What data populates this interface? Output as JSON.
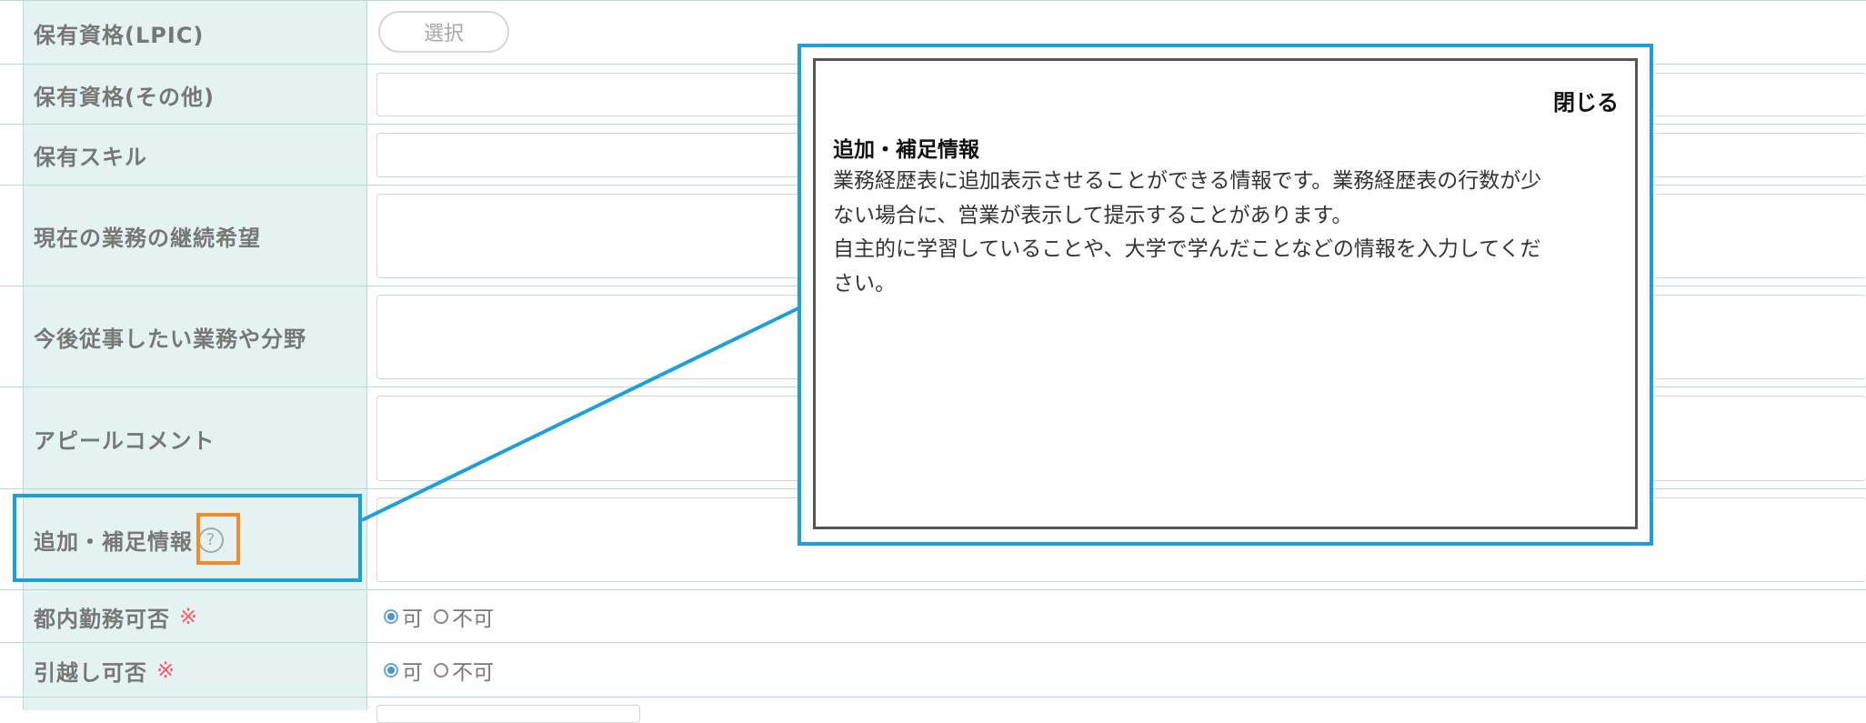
{
  "form": {
    "rows": [
      {
        "label": "保有資格(LPIC)",
        "select_label": "選択"
      },
      {
        "label": "保有資格(その他)"
      },
      {
        "label": "保有スキル"
      },
      {
        "label": "現在の業務の継続希望"
      },
      {
        "label": "今後従事したい業務や分野"
      },
      {
        "label": "アピールコメント"
      },
      {
        "label": "追加・補足情報",
        "help_icon": "question-circle-icon"
      },
      {
        "label": "都内勤務可否",
        "required_mark": "※",
        "options": [
          "可",
          "不可"
        ],
        "selected": "可"
      },
      {
        "label": "引越し可否",
        "required_mark": "※",
        "options": [
          "可",
          "不可"
        ],
        "selected": "可"
      }
    ]
  },
  "popup": {
    "close_label": "閉じる",
    "title": "追加・補足情報",
    "lines": [
      "業務経歴表に追加表示させることができる情報です。業務経歴表の行数が少",
      "ない場合に、営業が表示して提示することがあります。",
      "自主的に学習していることや、大学で学んだことなどの情報を入力してくだ",
      "さい。"
    ]
  },
  "annotation_colors": {
    "highlight_blue": "#1aa0dc",
    "highlight_orange": "#f08a2f"
  }
}
